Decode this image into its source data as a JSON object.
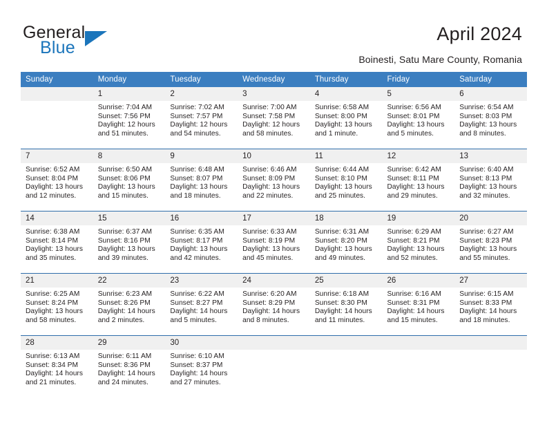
{
  "logo": {
    "word1": "General",
    "word2": "Blue",
    "triangle_color": "#1b75bb",
    "text_color": "#231f20"
  },
  "header": {
    "title": "April 2024",
    "subtitle": "Boinesti, Satu Mare County, Romania"
  },
  "calendar": {
    "header_bg": "#3b7ec0",
    "header_text_color": "#ffffff",
    "daynum_bg": "#f0f0f0",
    "row_rule_color": "#2e6daa",
    "weekday_headers": [
      "Sunday",
      "Monday",
      "Tuesday",
      "Wednesday",
      "Thursday",
      "Friday",
      "Saturday"
    ],
    "weeks": [
      [
        {
          "day": "",
          "sunrise": "",
          "sunset": "",
          "daylight_line1": "",
          "daylight_line2": ""
        },
        {
          "day": "1",
          "sunrise": "Sunrise: 7:04 AM",
          "sunset": "Sunset: 7:56 PM",
          "daylight_line1": "Daylight: 12 hours",
          "daylight_line2": "and 51 minutes."
        },
        {
          "day": "2",
          "sunrise": "Sunrise: 7:02 AM",
          "sunset": "Sunset: 7:57 PM",
          "daylight_line1": "Daylight: 12 hours",
          "daylight_line2": "and 54 minutes."
        },
        {
          "day": "3",
          "sunrise": "Sunrise: 7:00 AM",
          "sunset": "Sunset: 7:58 PM",
          "daylight_line1": "Daylight: 12 hours",
          "daylight_line2": "and 58 minutes."
        },
        {
          "day": "4",
          "sunrise": "Sunrise: 6:58 AM",
          "sunset": "Sunset: 8:00 PM",
          "daylight_line1": "Daylight: 13 hours",
          "daylight_line2": "and 1 minute."
        },
        {
          "day": "5",
          "sunrise": "Sunrise: 6:56 AM",
          "sunset": "Sunset: 8:01 PM",
          "daylight_line1": "Daylight: 13 hours",
          "daylight_line2": "and 5 minutes."
        },
        {
          "day": "6",
          "sunrise": "Sunrise: 6:54 AM",
          "sunset": "Sunset: 8:03 PM",
          "daylight_line1": "Daylight: 13 hours",
          "daylight_line2": "and 8 minutes."
        }
      ],
      [
        {
          "day": "7",
          "sunrise": "Sunrise: 6:52 AM",
          "sunset": "Sunset: 8:04 PM",
          "daylight_line1": "Daylight: 13 hours",
          "daylight_line2": "and 12 minutes."
        },
        {
          "day": "8",
          "sunrise": "Sunrise: 6:50 AM",
          "sunset": "Sunset: 8:06 PM",
          "daylight_line1": "Daylight: 13 hours",
          "daylight_line2": "and 15 minutes."
        },
        {
          "day": "9",
          "sunrise": "Sunrise: 6:48 AM",
          "sunset": "Sunset: 8:07 PM",
          "daylight_line1": "Daylight: 13 hours",
          "daylight_line2": "and 18 minutes."
        },
        {
          "day": "10",
          "sunrise": "Sunrise: 6:46 AM",
          "sunset": "Sunset: 8:09 PM",
          "daylight_line1": "Daylight: 13 hours",
          "daylight_line2": "and 22 minutes."
        },
        {
          "day": "11",
          "sunrise": "Sunrise: 6:44 AM",
          "sunset": "Sunset: 8:10 PM",
          "daylight_line1": "Daylight: 13 hours",
          "daylight_line2": "and 25 minutes."
        },
        {
          "day": "12",
          "sunrise": "Sunrise: 6:42 AM",
          "sunset": "Sunset: 8:11 PM",
          "daylight_line1": "Daylight: 13 hours",
          "daylight_line2": "and 29 minutes."
        },
        {
          "day": "13",
          "sunrise": "Sunrise: 6:40 AM",
          "sunset": "Sunset: 8:13 PM",
          "daylight_line1": "Daylight: 13 hours",
          "daylight_line2": "and 32 minutes."
        }
      ],
      [
        {
          "day": "14",
          "sunrise": "Sunrise: 6:38 AM",
          "sunset": "Sunset: 8:14 PM",
          "daylight_line1": "Daylight: 13 hours",
          "daylight_line2": "and 35 minutes."
        },
        {
          "day": "15",
          "sunrise": "Sunrise: 6:37 AM",
          "sunset": "Sunset: 8:16 PM",
          "daylight_line1": "Daylight: 13 hours",
          "daylight_line2": "and 39 minutes."
        },
        {
          "day": "16",
          "sunrise": "Sunrise: 6:35 AM",
          "sunset": "Sunset: 8:17 PM",
          "daylight_line1": "Daylight: 13 hours",
          "daylight_line2": "and 42 minutes."
        },
        {
          "day": "17",
          "sunrise": "Sunrise: 6:33 AM",
          "sunset": "Sunset: 8:19 PM",
          "daylight_line1": "Daylight: 13 hours",
          "daylight_line2": "and 45 minutes."
        },
        {
          "day": "18",
          "sunrise": "Sunrise: 6:31 AM",
          "sunset": "Sunset: 8:20 PM",
          "daylight_line1": "Daylight: 13 hours",
          "daylight_line2": "and 49 minutes."
        },
        {
          "day": "19",
          "sunrise": "Sunrise: 6:29 AM",
          "sunset": "Sunset: 8:21 PM",
          "daylight_line1": "Daylight: 13 hours",
          "daylight_line2": "and 52 minutes."
        },
        {
          "day": "20",
          "sunrise": "Sunrise: 6:27 AM",
          "sunset": "Sunset: 8:23 PM",
          "daylight_line1": "Daylight: 13 hours",
          "daylight_line2": "and 55 minutes."
        }
      ],
      [
        {
          "day": "21",
          "sunrise": "Sunrise: 6:25 AM",
          "sunset": "Sunset: 8:24 PM",
          "daylight_line1": "Daylight: 13 hours",
          "daylight_line2": "and 58 minutes."
        },
        {
          "day": "22",
          "sunrise": "Sunrise: 6:23 AM",
          "sunset": "Sunset: 8:26 PM",
          "daylight_line1": "Daylight: 14 hours",
          "daylight_line2": "and 2 minutes."
        },
        {
          "day": "23",
          "sunrise": "Sunrise: 6:22 AM",
          "sunset": "Sunset: 8:27 PM",
          "daylight_line1": "Daylight: 14 hours",
          "daylight_line2": "and 5 minutes."
        },
        {
          "day": "24",
          "sunrise": "Sunrise: 6:20 AM",
          "sunset": "Sunset: 8:29 PM",
          "daylight_line1": "Daylight: 14 hours",
          "daylight_line2": "and 8 minutes."
        },
        {
          "day": "25",
          "sunrise": "Sunrise: 6:18 AM",
          "sunset": "Sunset: 8:30 PM",
          "daylight_line1": "Daylight: 14 hours",
          "daylight_line2": "and 11 minutes."
        },
        {
          "day": "26",
          "sunrise": "Sunrise: 6:16 AM",
          "sunset": "Sunset: 8:31 PM",
          "daylight_line1": "Daylight: 14 hours",
          "daylight_line2": "and 15 minutes."
        },
        {
          "day": "27",
          "sunrise": "Sunrise: 6:15 AM",
          "sunset": "Sunset: 8:33 PM",
          "daylight_line1": "Daylight: 14 hours",
          "daylight_line2": "and 18 minutes."
        }
      ],
      [
        {
          "day": "28",
          "sunrise": "Sunrise: 6:13 AM",
          "sunset": "Sunset: 8:34 PM",
          "daylight_line1": "Daylight: 14 hours",
          "daylight_line2": "and 21 minutes."
        },
        {
          "day": "29",
          "sunrise": "Sunrise: 6:11 AM",
          "sunset": "Sunset: 8:36 PM",
          "daylight_line1": "Daylight: 14 hours",
          "daylight_line2": "and 24 minutes."
        },
        {
          "day": "30",
          "sunrise": "Sunrise: 6:10 AM",
          "sunset": "Sunset: 8:37 PM",
          "daylight_line1": "Daylight: 14 hours",
          "daylight_line2": "and 27 minutes."
        },
        {
          "day": "",
          "sunrise": "",
          "sunset": "",
          "daylight_line1": "",
          "daylight_line2": ""
        },
        {
          "day": "",
          "sunrise": "",
          "sunset": "",
          "daylight_line1": "",
          "daylight_line2": ""
        },
        {
          "day": "",
          "sunrise": "",
          "sunset": "",
          "daylight_line1": "",
          "daylight_line2": ""
        },
        {
          "day": "",
          "sunrise": "",
          "sunset": "",
          "daylight_line1": "",
          "daylight_line2": ""
        }
      ]
    ]
  }
}
